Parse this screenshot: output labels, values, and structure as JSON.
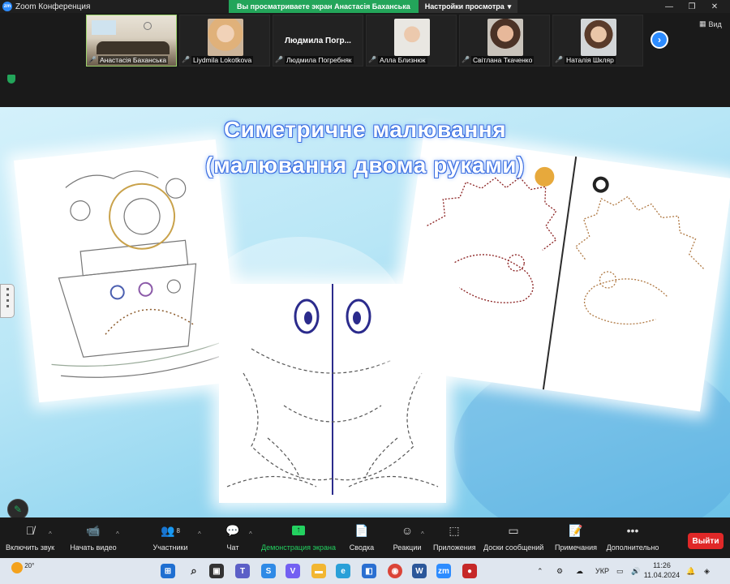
{
  "window": {
    "title": "Zoom Конференция",
    "share_banner": "Вы просматриваете экран Анастасія Баханська",
    "view_settings": "Настройки просмотра",
    "view_label": "Вид"
  },
  "participants": [
    {
      "name": "Анастасія Баханська",
      "muted": false,
      "active": true
    },
    {
      "name": "Liydmila Lokotkova",
      "muted": true
    },
    {
      "name": "Людмила Погребняк",
      "muted": true,
      "display_name": "Людмила  Погр..."
    },
    {
      "name": "Алла Близнюк",
      "muted": true
    },
    {
      "name": "Світлана Ткаченко",
      "muted": true
    },
    {
      "name": "Наталія Шкляр",
      "muted": true
    }
  ],
  "slide": {
    "title_line1": "Симетричне малювання",
    "title_line2": "(малювання двома руками)"
  },
  "toolbar": {
    "audio": "Включить звук",
    "video": "Начать видео",
    "participants": "Участники",
    "participants_count": "8",
    "chat": "Чат",
    "share": "Демонстрация экрана",
    "summary": "Сводка",
    "reactions": "Реакции",
    "apps": "Приложения",
    "whiteboards": "Доски сообщений",
    "notes": "Примечания",
    "more": "Дополнительно",
    "leave": "Выйти"
  },
  "taskbar": {
    "weather": "20°",
    "language": "УКР",
    "time": "11:26",
    "date": "11.04.2024"
  },
  "colors": {
    "zoom_blue": "#2d8cff",
    "share_green": "#23a55a",
    "leave_red": "#e02828"
  }
}
